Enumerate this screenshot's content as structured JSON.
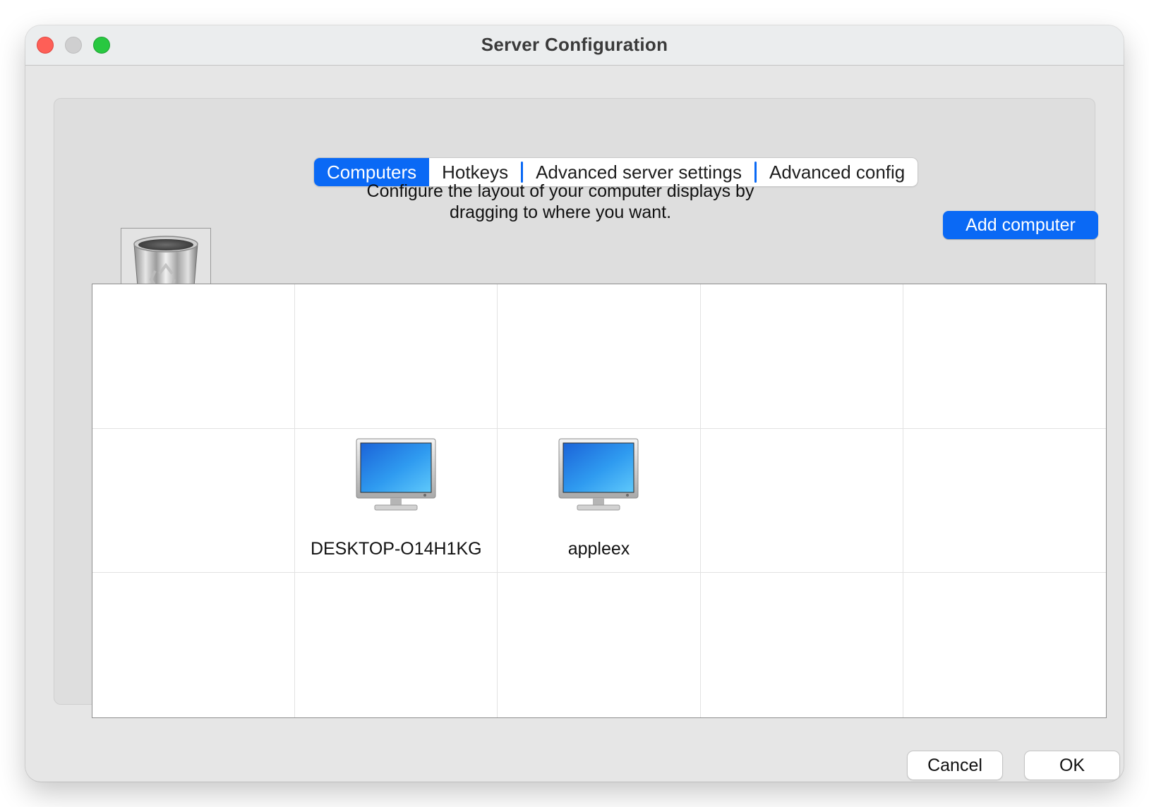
{
  "window": {
    "title": "Server Configuration"
  },
  "tabs": [
    {
      "label": "Computers",
      "active": true
    },
    {
      "label": "Hotkeys",
      "active": false
    },
    {
      "label": "Advanced server settings",
      "active": false
    },
    {
      "label": "Advanced config",
      "active": false
    }
  ],
  "computers_tab": {
    "instructions": "Configure the layout of your computer displays by dragging to where you want.",
    "add_button": "Add computer",
    "trash_icon": "trash-icon",
    "grid": {
      "columns": 5,
      "rows": 3,
      "screens": [
        {
          "name": "DESKTOP-O14H1KG",
          "row": 2,
          "column": 2
        },
        {
          "name": "appleex",
          "row": 2,
          "column": 3
        }
      ]
    }
  },
  "footer": {
    "cancel": "Cancel",
    "ok": "OK"
  },
  "colors": {
    "accent": "#0a69f5",
    "close": "#fe5f57",
    "minimize": "#cfcfd0",
    "maximize": "#28c840"
  }
}
